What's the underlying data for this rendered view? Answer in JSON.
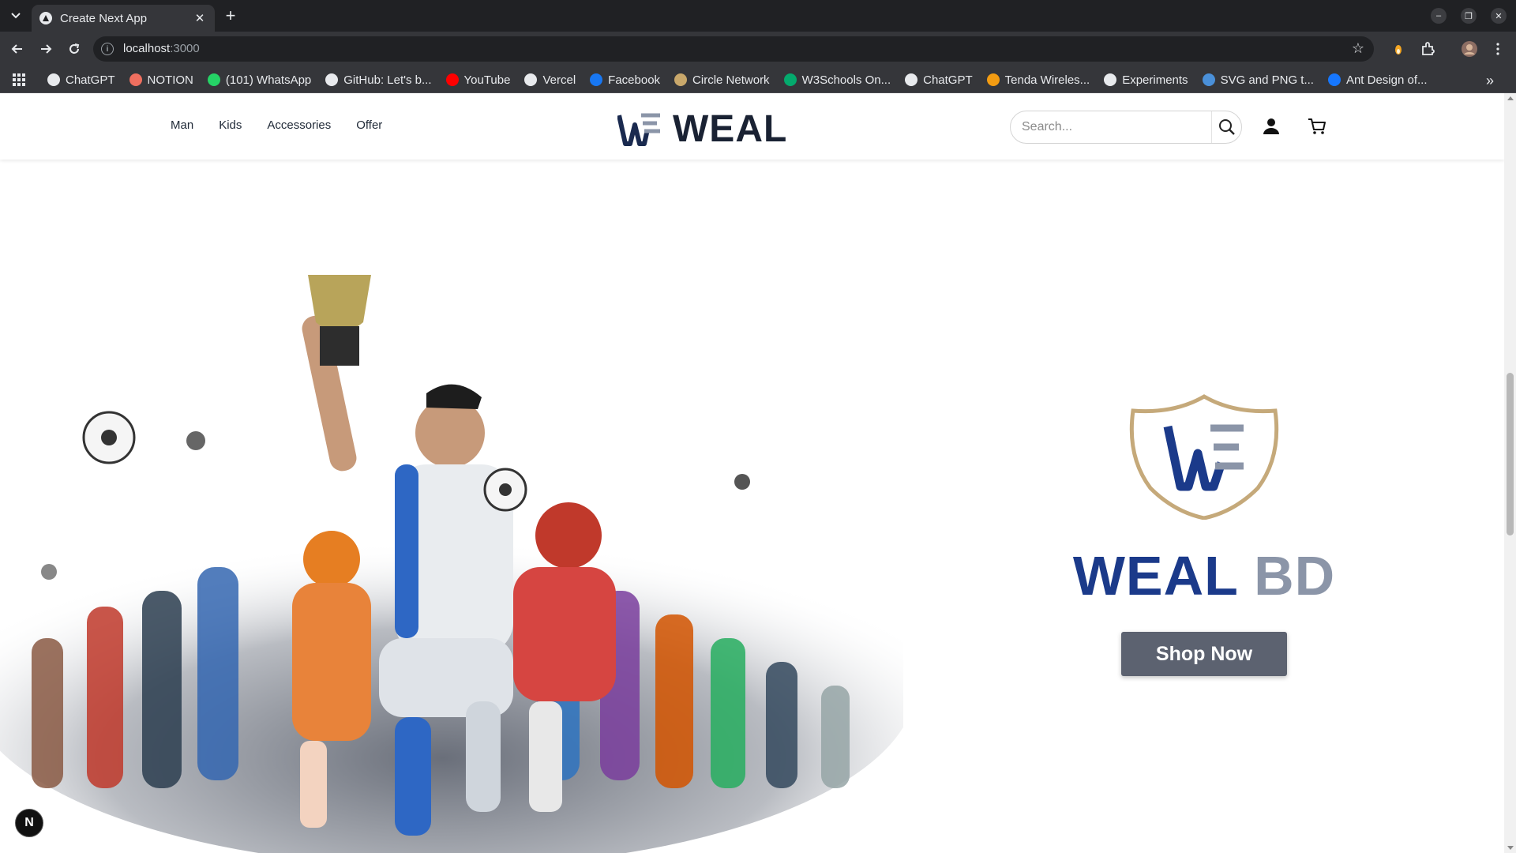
{
  "browser": {
    "tab": {
      "title": "Create Next App",
      "close": "✕"
    },
    "new_tab": "+",
    "url": {
      "host": "localhost",
      "port": ":3000"
    },
    "bookmarks": [
      {
        "label": "ChatGPT",
        "icon": "chatgpt-icon",
        "color": "#e8eaed"
      },
      {
        "label": "NOTION",
        "icon": "code-icon",
        "color": "#ef6f5f"
      },
      {
        "label": "(101) WhatsApp",
        "icon": "whatsapp-icon",
        "color": "#25d366"
      },
      {
        "label": "GitHub: Let's b...",
        "icon": "github-icon",
        "color": "#e8eaed"
      },
      {
        "label": "YouTube",
        "icon": "youtube-icon",
        "color": "#ff0000"
      },
      {
        "label": "Vercel",
        "icon": "folder-icon",
        "color": "#e8eaed"
      },
      {
        "label": "Facebook",
        "icon": "facebook-icon",
        "color": "#1877f2"
      },
      {
        "label": "Circle Network",
        "icon": "circle-network-icon",
        "color": "#c9a86b"
      },
      {
        "label": "W3Schools On...",
        "icon": "w3schools-icon",
        "color": "#04aa6d"
      },
      {
        "label": "ChatGPT",
        "icon": "chatgpt-icon",
        "color": "#e8eaed"
      },
      {
        "label": "Tenda Wireles...",
        "icon": "tenda-icon",
        "color": "#f39c12"
      },
      {
        "label": "Experiments",
        "icon": "flask-icon",
        "color": "#e8eaed"
      },
      {
        "label": "SVG and PNG t...",
        "icon": "svg-icon",
        "color": "#4a90d9"
      },
      {
        "label": "Ant Design of...",
        "icon": "ant-design-icon",
        "color": "#1677ff"
      }
    ],
    "bookmarks_more": "»"
  },
  "site": {
    "nav": [
      "Man",
      "Kids",
      "Accessories",
      "Offer"
    ],
    "brand": "WEAL",
    "search_placeholder": "Search...",
    "hero": {
      "title_primary": "WEAL",
      "title_secondary": "BD",
      "cta": "Shop Now"
    },
    "dev_badge": "N"
  },
  "colors": {
    "brand_navy": "#1b3a8a",
    "brand_grey": "#8b95a8",
    "shield_gold": "#c5a97a",
    "cta_bg": "#5c6270"
  }
}
